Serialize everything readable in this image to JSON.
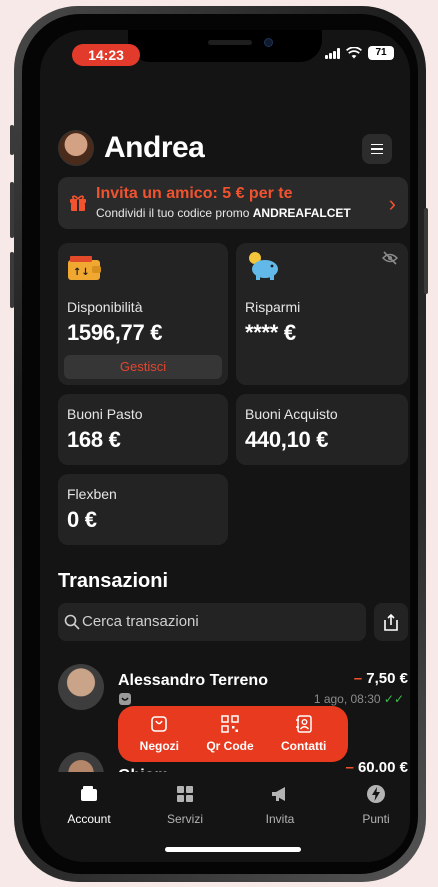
{
  "status_bar": {
    "time": "14:23",
    "battery": "71"
  },
  "header": {
    "name": "Andrea"
  },
  "invite": {
    "title": "Invita un amico: 5 € per te",
    "subtitle_prefix": "Condividi il tuo codice promo ",
    "promo_code": "ANDREAFALCET"
  },
  "cards": {
    "disponibilita": {
      "label": "Disponibilità",
      "value": "1596,77 €",
      "action": "Gestisci"
    },
    "risparmi": {
      "label": "Risparmi",
      "value": "**** €"
    },
    "buoni_pasto": {
      "label": "Buoni Pasto",
      "value": "168 €"
    },
    "buoni_acquisto": {
      "label": "Buoni Acquisto",
      "value": "440,10 €"
    },
    "flexben": {
      "label": "Flexben",
      "value": "0 €"
    }
  },
  "transactions": {
    "title": "Transazioni",
    "search_placeholder": "Cerca transazioni",
    "items": [
      {
        "name": "Alessandro Terreno",
        "amount_sign": "–",
        "amount": "7,50 €",
        "date": "1 ago, 08:30"
      },
      {
        "name": "Ghiom",
        "amount_sign": "–",
        "amount": "60,00 €",
        "date": ""
      }
    ]
  },
  "fab": {
    "negozi": "Negozi",
    "qr": "Qr Code",
    "contatti": "Contatti"
  },
  "tabbar": {
    "account": "Account",
    "servizi": "Servizi",
    "invita": "Invita",
    "punti": "Punti"
  },
  "colors": {
    "accent": "#f2532f",
    "fab": "#e83a1e",
    "background": "#141414",
    "card": "#232323"
  }
}
